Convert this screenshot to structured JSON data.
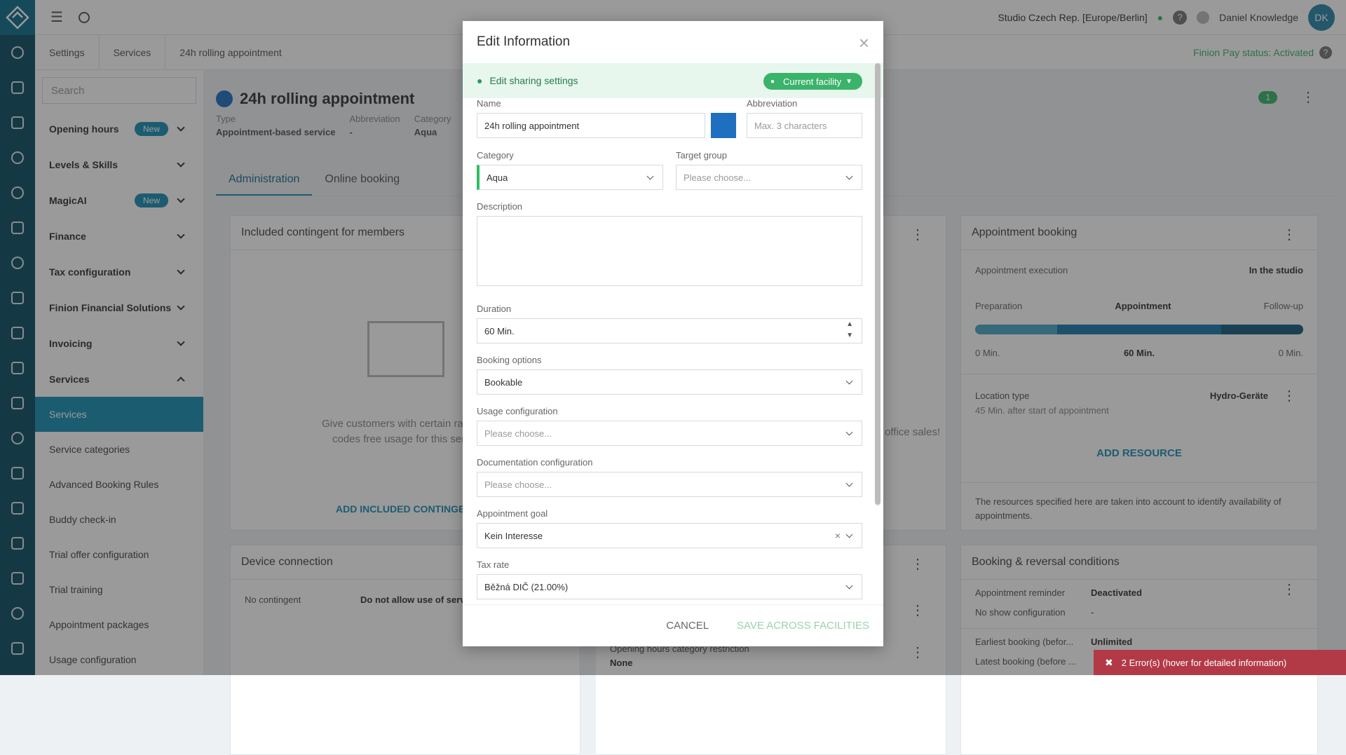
{
  "topbar": {
    "studio": "Studio Czech Rep. [Europe/Berlin]",
    "user": "Daniel Knowledge",
    "initials": "DK"
  },
  "breadcrumb": [
    "Settings",
    "Services",
    "24h rolling appointment"
  ],
  "pay_status": "Finion Pay status: Activated",
  "nav": {
    "search_placeholder": "Search",
    "groups": [
      {
        "label": "Opening hours",
        "badge": "New"
      },
      {
        "label": "Levels & Skills"
      },
      {
        "label": "MagicAI",
        "badge": "New"
      },
      {
        "label": "Finance"
      },
      {
        "label": "Tax configuration"
      },
      {
        "label": "Finion Financial Solutions"
      },
      {
        "label": "Invoicing"
      },
      {
        "label": "Services"
      }
    ],
    "items": [
      "Services",
      "Service categories",
      "Advanced Booking Rules",
      "Buddy check-in",
      "Trial offer configuration",
      "Trial training",
      "Appointment packages",
      "Usage configuration"
    ]
  },
  "service": {
    "title": "24h rolling appointment",
    "type_label": "Type",
    "type_value": "Appointment-based service",
    "abbr_label": "Abbreviation",
    "abbr_value": "-",
    "cat_label": "Category",
    "cat_value": "Aqua",
    "pin_count": "1"
  },
  "tabs": [
    "Administration",
    "Online booking"
  ],
  "cards": {
    "contingent_title": "Included contingent for members",
    "contingent_text_1": "Give customers with certain ra",
    "contingent_text_2": "codes free usage for this serv",
    "contingent_link": "ADD INCLUDED CONTINGE",
    "office_sales": "office sales!",
    "device_title": "Device connection",
    "no_contingent": "No contingent",
    "do_not_allow": "Do not allow use of servi",
    "opening_restriction": "Opening hours category restriction",
    "none": "None",
    "booking_title": "Appointment booking",
    "exec_label": "Appointment execution",
    "exec_value": "In the studio",
    "prep": "Preparation",
    "appt": "Appointment",
    "follow": "Follow-up",
    "prep_min": "0 Min.",
    "appt_min": "60 Min.",
    "follow_min": "0 Min.",
    "prep_share": 0.25,
    "appt_share": 0.5,
    "follow_share": 0.25,
    "loc_label": "Location type",
    "loc_value": "Hydro-Geräte",
    "loc_sub": "45 Min. after start of appointment",
    "add_resource": "ADD RESOURCE",
    "resource_note": "The resources specified here are taken into account to identify availability of appointments.",
    "reversal_title": "Booking & reversal conditions",
    "reminder_label": "Appointment reminder",
    "reminder_value": "Deactivated",
    "noshow_label": "No show configuration",
    "noshow_value": "-",
    "earliest_label": "Earliest booking (befor...",
    "earliest_value": "Unlimited",
    "latest_label": "Latest booking (before ..."
  },
  "modal": {
    "title": "Edit Information",
    "share_label": "Edit sharing settings",
    "share_button": "Current facility",
    "name_label": "Name",
    "name_value": "24h rolling appointment",
    "abbr_label": "Abbreviation",
    "abbr_placeholder": "Max. 3 characters",
    "category_label": "Category",
    "category_value": "Aqua",
    "target_label": "Target group",
    "target_placeholder": "Please choose...",
    "desc_label": "Description",
    "duration_label": "Duration",
    "duration_value": "60 Min.",
    "booking_label": "Booking options",
    "booking_value": "Bookable",
    "usage_label": "Usage configuration",
    "usage_placeholder": "Please choose...",
    "doc_label": "Documentation configuration",
    "doc_placeholder": "Please choose...",
    "goal_label": "Appointment goal",
    "goal_value": "Kein Interesse",
    "tax_label": "Tax rate",
    "tax_value": "Běžná DIČ (21.00%)",
    "cancel": "CANCEL",
    "save": "SAVE ACROSS FACILITIES"
  },
  "error": "2 Error(s) (hover for detailed information)",
  "colors": {
    "accent": "#1a8fb5",
    "green": "#3bb36b",
    "service_dot": "#1f6fc0",
    "error": "#b23a47"
  }
}
